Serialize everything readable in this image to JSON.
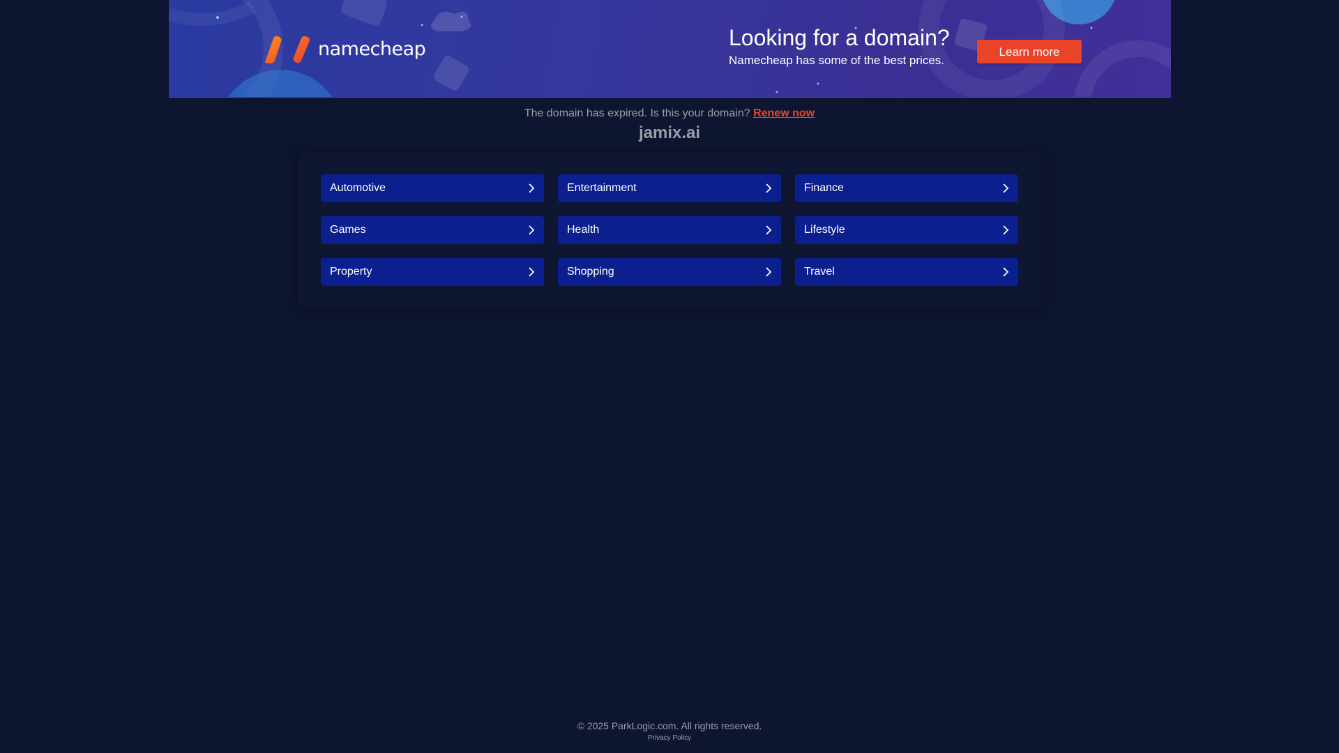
{
  "banner": {
    "logo_text": "namecheap",
    "heading": "Looking for a domain?",
    "subheading": "Namecheap has some of the best prices.",
    "button_label": "Learn more"
  },
  "notice": {
    "message": "The domain has expired. Is this your domain?",
    "renew_link": "Renew now"
  },
  "domain": "jamix.ai",
  "categories": [
    {
      "label": "Automotive"
    },
    {
      "label": "Entertainment"
    },
    {
      "label": "Finance"
    },
    {
      "label": "Games"
    },
    {
      "label": "Health"
    },
    {
      "label": "Lifestyle"
    },
    {
      "label": "Property"
    },
    {
      "label": "Shopping"
    },
    {
      "label": "Travel"
    }
  ],
  "footer": {
    "copyright": "© 2025 ParkLogic.com. All rights reserved.",
    "privacy": "Privacy Policy"
  },
  "icons": {
    "logo": "namecheap-logo-icon",
    "category_arrow": "chevron-right-icon"
  },
  "colors": {
    "background": "#0d1530",
    "banner": "#35389e",
    "accent": "#e9432a",
    "category_button": "#0b1f8f",
    "muted_text": "#9a9ea8"
  }
}
